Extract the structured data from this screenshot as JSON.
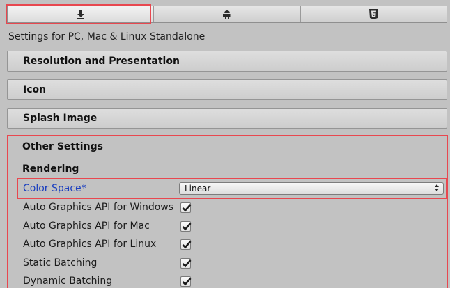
{
  "tabs": [
    {
      "icon": "download-icon",
      "selected": true
    },
    {
      "icon": "android-icon",
      "selected": false
    },
    {
      "icon": "html5-icon",
      "selected": false
    }
  ],
  "settings_for": "Settings for PC, Mac & Linux Standalone",
  "sections": {
    "resolution": "Resolution and Presentation",
    "icon": "Icon",
    "splash": "Splash Image",
    "other": "Other Settings"
  },
  "rendering": {
    "title": "Rendering",
    "color_space_label": "Color Space*",
    "color_space_value": "Linear",
    "properties": [
      {
        "label": "Auto Graphics API for Windows",
        "checked": true
      },
      {
        "label": "Auto Graphics API for Mac",
        "checked": true
      },
      {
        "label": "Auto Graphics API for Linux",
        "checked": true
      },
      {
        "label": "Static Batching",
        "checked": true
      },
      {
        "label": "Dynamic Batching",
        "checked": true
      }
    ]
  },
  "colors": {
    "highlight": "#e8474f",
    "modified_label": "#1b3fbf"
  }
}
